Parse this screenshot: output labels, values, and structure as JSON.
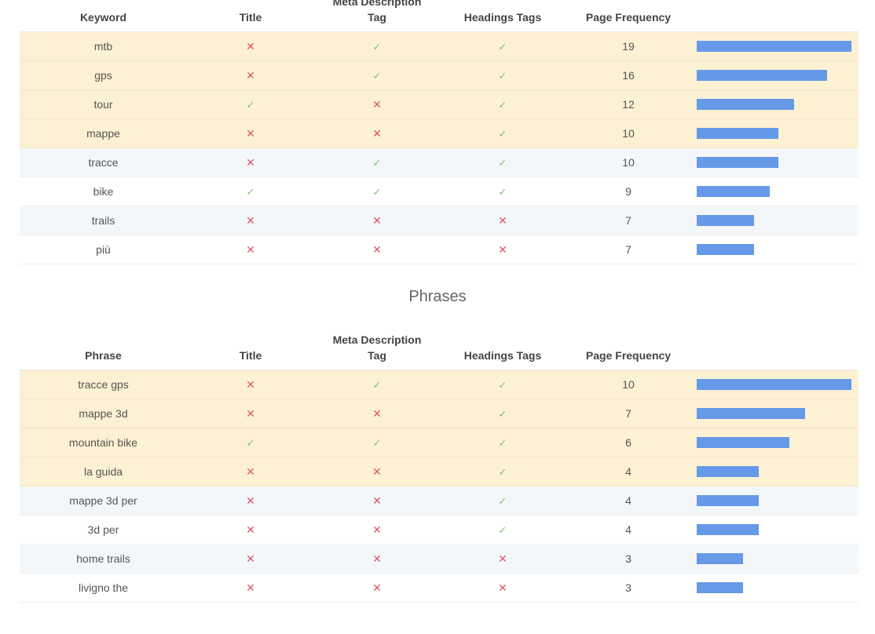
{
  "marks": {
    "no": "✕",
    "yes": "✓"
  },
  "colors": {
    "bar": "#6699e8",
    "highlight_row": "#fdf1d3",
    "alt_row": "#f4f7fa",
    "no_mark": "#e0556b",
    "yes_mark": "#79c36a"
  },
  "keywords": {
    "headers": {
      "term": "Keyword",
      "title": "Title",
      "meta": "Meta Description\nTag",
      "headings": "Headings Tags",
      "freq": "Page Frequency"
    },
    "max_frequency": 19,
    "rows": [
      {
        "term": "mtb",
        "title": false,
        "meta": true,
        "headings": true,
        "freq": 19,
        "style": "hl"
      },
      {
        "term": "gps",
        "title": false,
        "meta": true,
        "headings": true,
        "freq": 16,
        "style": "hl"
      },
      {
        "term": "tour",
        "title": true,
        "meta": false,
        "headings": true,
        "freq": 12,
        "style": "hl"
      },
      {
        "term": "mappe",
        "title": false,
        "meta": false,
        "headings": true,
        "freq": 10,
        "style": "hl"
      },
      {
        "term": "tracce",
        "title": false,
        "meta": true,
        "headings": true,
        "freq": 10,
        "style": "alt"
      },
      {
        "term": "bike",
        "title": true,
        "meta": true,
        "headings": true,
        "freq": 9,
        "style": "plain"
      },
      {
        "term": "trails",
        "title": false,
        "meta": false,
        "headings": false,
        "freq": 7,
        "style": "alt"
      },
      {
        "term": "più",
        "title": false,
        "meta": false,
        "headings": false,
        "freq": 7,
        "style": "plain"
      }
    ]
  },
  "phrases_section_title": "Phrases",
  "phrases": {
    "headers": {
      "term": "Phrase",
      "title": "Title",
      "meta": "Meta Description\nTag",
      "headings": "Headings Tags",
      "freq": "Page Frequency"
    },
    "max_frequency": 10,
    "rows": [
      {
        "term": "tracce gps",
        "title": false,
        "meta": true,
        "headings": true,
        "freq": 10,
        "style": "hl"
      },
      {
        "term": "mappe 3d",
        "title": false,
        "meta": false,
        "headings": true,
        "freq": 7,
        "style": "hl"
      },
      {
        "term": "mountain bike",
        "title": true,
        "meta": true,
        "headings": true,
        "freq": 6,
        "style": "hl"
      },
      {
        "term": "la guida",
        "title": false,
        "meta": false,
        "headings": true,
        "freq": 4,
        "style": "hl"
      },
      {
        "term": "mappe 3d per",
        "title": false,
        "meta": false,
        "headings": true,
        "freq": 4,
        "style": "alt"
      },
      {
        "term": "3d per",
        "title": false,
        "meta": false,
        "headings": true,
        "freq": 4,
        "style": "plain"
      },
      {
        "term": "home trails",
        "title": false,
        "meta": false,
        "headings": false,
        "freq": 3,
        "style": "alt"
      },
      {
        "term": "livigno the",
        "title": false,
        "meta": false,
        "headings": false,
        "freq": 3,
        "style": "plain"
      }
    ]
  }
}
